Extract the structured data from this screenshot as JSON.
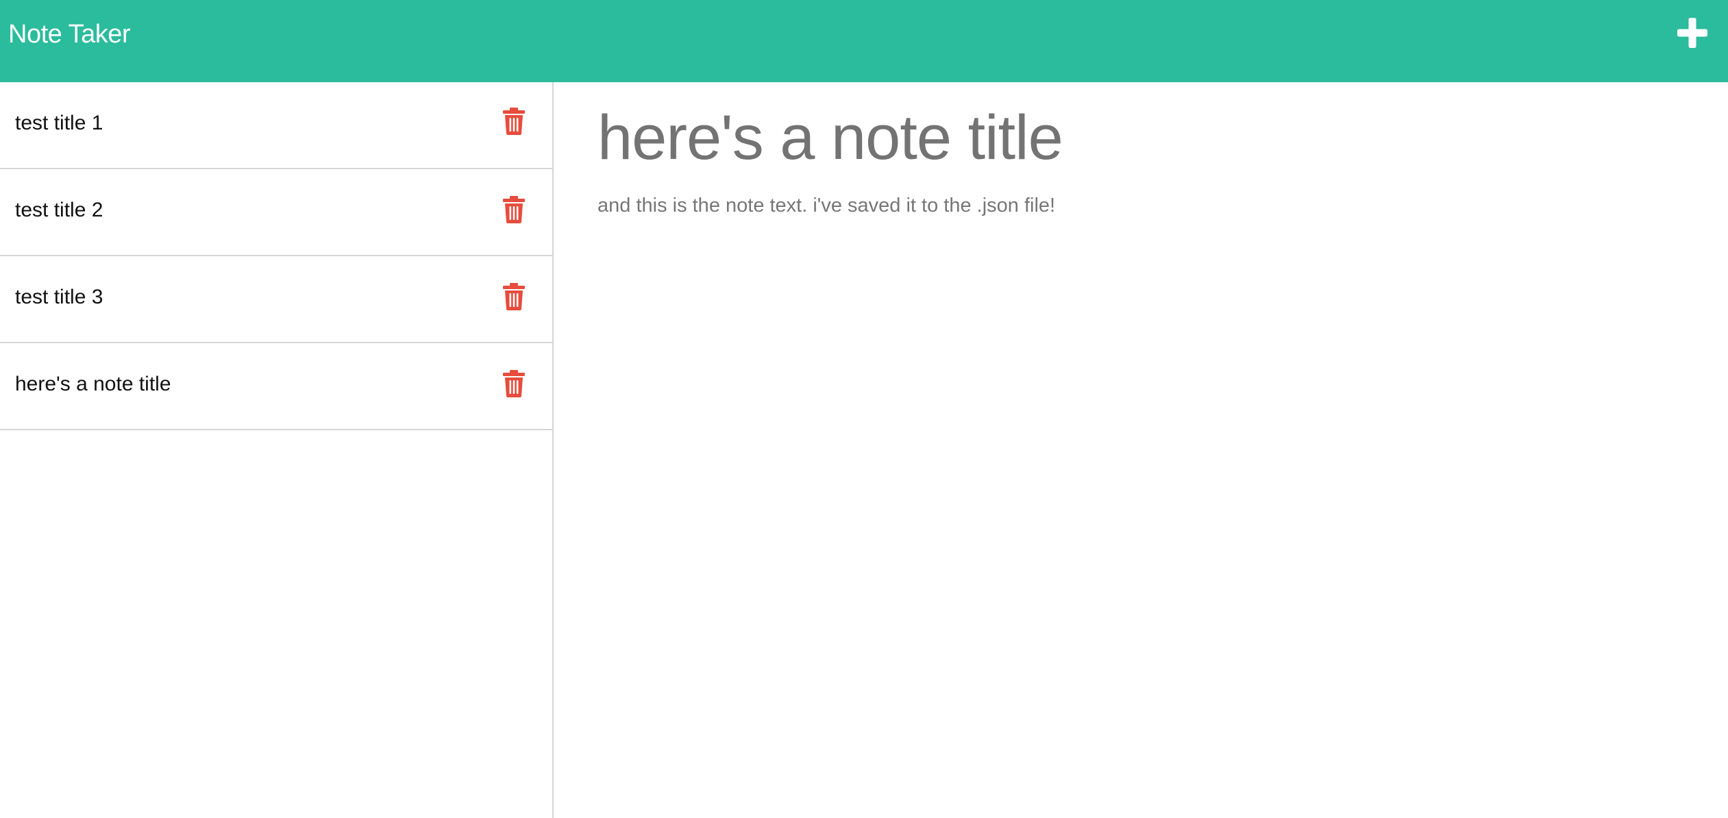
{
  "navbar": {
    "brand": "Note Taker",
    "new_note_icon": "plus-icon",
    "background_color": "#2abc9c"
  },
  "sidebar": {
    "notes": [
      {
        "title": "test title 1",
        "icon": "trash-icon"
      },
      {
        "title": "test title 2",
        "icon": "trash-icon"
      },
      {
        "title": "test title 3",
        "icon": "trash-icon"
      },
      {
        "title": "here's a note title",
        "icon": "trash-icon"
      }
    ],
    "delete_icon_color": "#e74c3c"
  },
  "editor": {
    "title": "here's a note title",
    "text": "and this is the note text. i've saved it to the .json file!"
  }
}
